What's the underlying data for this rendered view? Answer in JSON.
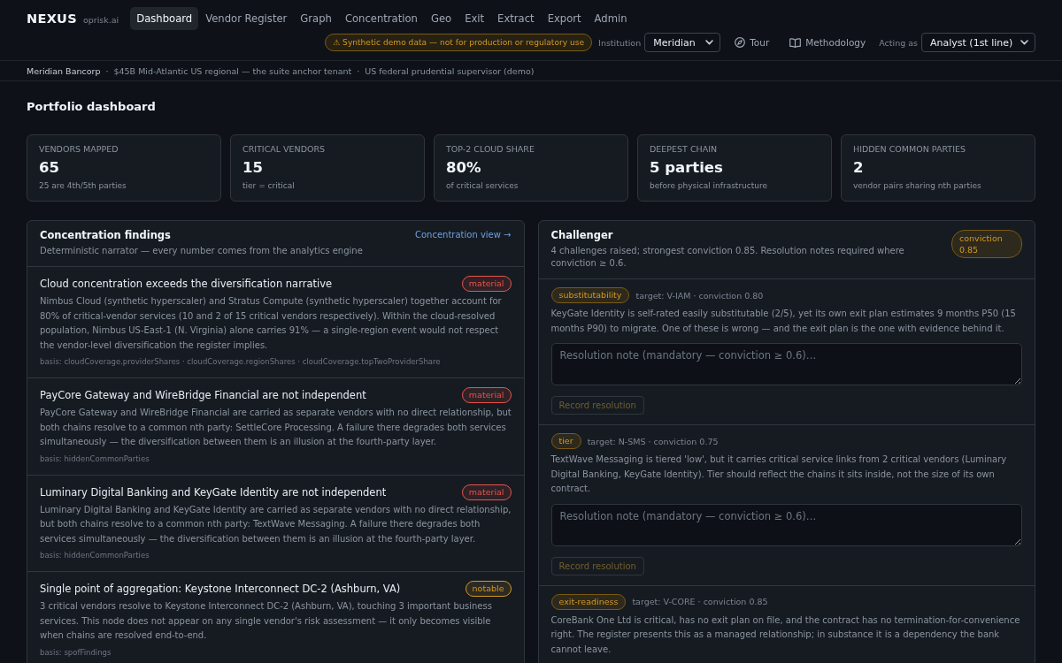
{
  "header": {
    "logo": "NEXUS",
    "domain": "oprisk.ai",
    "tabs": [
      {
        "label": "Dashboard",
        "selected": true
      },
      {
        "label": "Vendor Register",
        "selected": false
      },
      {
        "label": "Graph",
        "selected": false
      },
      {
        "label": "Concentration",
        "selected": false
      },
      {
        "label": "Geo",
        "selected": false
      },
      {
        "label": "Exit",
        "selected": false
      },
      {
        "label": "Extract",
        "selected": false
      },
      {
        "label": "Export",
        "selected": false
      },
      {
        "label": "Admin",
        "selected": false
      }
    ],
    "demo_notice": "⚠ Synthetic demo data — not for production or regulatory use",
    "institution": {
      "label": "Institution",
      "value": "Meridian"
    },
    "tour": "Tour",
    "methodology": "Methodology",
    "acting_as": {
      "label": "Acting as",
      "value": "Analyst (1st line)"
    }
  },
  "context_bar": {
    "institution": "Meridian Bancorp",
    "separator": "·",
    "details": [
      "$45B Mid-Atlantic US regional — the suite anchor tenant",
      "US federal prudential supervisor (demo)"
    ]
  },
  "page_title": "Portfolio dashboard",
  "stats": [
    {
      "label": "VENDORS MAPPED",
      "value": "65",
      "note": "25 are 4th/5th parties"
    },
    {
      "label": "CRITICAL VENDORS",
      "value": "15",
      "note": "tier = critical"
    },
    {
      "label": "TOP-2 CLOUD SHARE",
      "value": "80%",
      "note": "of critical services"
    },
    {
      "label": "DEEPEST CHAIN",
      "value": "5 parties",
      "note": "before physical infrastructure"
    },
    {
      "label": "HIDDEN COMMON PARTIES",
      "value": "2",
      "note": "vendor pairs sharing nth parties"
    }
  ],
  "findings_panel": {
    "title": "Concentration findings",
    "subtitle": "Deterministic narrator — every number comes from the analytics engine",
    "link": "Concentration view →",
    "findings": [
      {
        "title": "Cloud concentration exceeds the diversification narrative",
        "badge": {
          "label": "material",
          "color": "#e5534b"
        },
        "body": "Nimbus Cloud (synthetic hyperscaler) and Stratus Compute (synthetic hyperscaler) together account for 80% of critical-vendor services (10 and 2 of 15 critical vendors respectively). Within the cloud-resolved population, Nimbus US-East-1 (N. Virginia) alone carries 91% — a single-region event would not respect the vendor-level diversification the register implies.",
        "basis": "basis: cloudCoverage.providerShares · cloudCoverage.regionShares · cloudCoverage.topTwoProviderShare"
      },
      {
        "title": "PayCore Gateway and WireBridge Financial are not independent",
        "badge": {
          "label": "material",
          "color": "#e5534b"
        },
        "body": "PayCore Gateway and WireBridge Financial are carried as separate vendors with no direct relationship, but both chains resolve to a common nth party: SettleCore Processing. A failure there degrades both services simultaneously — the diversification between them is an illusion at the fourth-party layer.",
        "basis": "basis: hiddenCommonParties"
      },
      {
        "title": "Luminary Digital Banking and KeyGate Identity are not independent",
        "badge": {
          "label": "material",
          "color": "#e5534b"
        },
        "body": "Luminary Digital Banking and KeyGate Identity are carried as separate vendors with no direct relationship, but both chains resolve to a common nth party: TextWave Messaging. A failure there degrades both services simultaneously — the diversification between them is an illusion at the fourth-party layer.",
        "basis": "basis: hiddenCommonParties"
      },
      {
        "title": "Single point of aggregation: Keystone Interconnect DC-2 (Ashburn, VA)",
        "badge": {
          "label": "notable",
          "color": "#d29922"
        },
        "body": "3 critical vendors resolve to Keystone Interconnect DC-2 (Ashburn, VA), touching 3 important business services. This node does not appear on any single vendor's risk assessment — it only becomes visible when chains are resolved end-to-end.",
        "basis": "basis: spofFindings"
      }
    ]
  },
  "challenger": {
    "title": "Challenger",
    "subtitle": "4 challenges raised; strongest conviction 0.85. Resolution notes required where conviction ≥ 0.6.",
    "badge": "conviction 0.85",
    "challenges": [
      {
        "tag": "substitutability",
        "meta": "target: V-IAM · conviction 0.80",
        "body": "KeyGate Identity is self-rated easily substitutable (2/5), yet its own exit plan estimates 9 months P50 (15 months P90) to migrate. One of these is wrong — and the exit plan is the one with evidence behind it.",
        "note": {
          "placeholder": "Resolution note (mandatory — conviction ≥ 0.6)…"
        },
        "action": {
          "label": "Record resolution",
          "disabled": true
        }
      },
      {
        "tag": "tier",
        "meta": "target: N-SMS · conviction 0.75",
        "body": "TextWave Messaging is tiered 'low', but it carries critical service links from 2 critical vendors (Luminary Digital Banking, KeyGate Identity). Tier should reflect the chains it sits inside, not the size of its own contract.",
        "note": {
          "placeholder": "Resolution note (mandatory — conviction ≥ 0.6)…"
        },
        "action": {
          "label": "Record resolution",
          "disabled": true
        }
      },
      {
        "tag": "exit-readiness",
        "meta": "target: V-CORE · conviction 0.85",
        "body": "CoreBank One Ltd is critical, has no exit plan on file, and the contract has no termination-for-convenience right. The register presents this as a managed relationship; in substance it is a dependency the bank cannot leave."
      }
    ]
  }
}
